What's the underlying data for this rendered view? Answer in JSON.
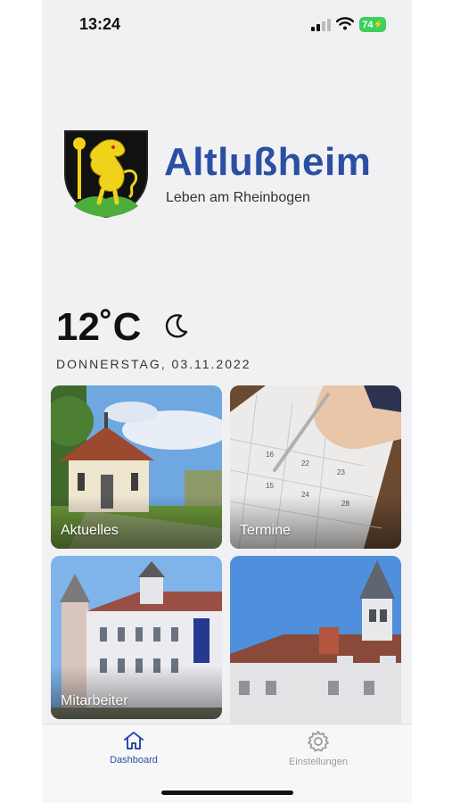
{
  "status_bar": {
    "time": "13:24",
    "battery": "74"
  },
  "brand": {
    "title": "Altlußheim",
    "subtitle": "Leben am Rheinbogen"
  },
  "weather": {
    "temperature": "12˚C",
    "condition_icon": "moon-icon"
  },
  "date": "DONNERSTAG, 03.11.2022",
  "tiles": [
    {
      "label": "Aktuelles"
    },
    {
      "label": "Termine"
    },
    {
      "label": "Mitarbeiter"
    },
    {
      "label": ""
    }
  ],
  "tabbar": {
    "items": [
      {
        "label": "Dashboard",
        "icon": "home-icon",
        "active": true
      },
      {
        "label": "Einstellungen",
        "icon": "gear-icon",
        "active": false
      }
    ]
  },
  "colors": {
    "brand_blue": "#2a4fa3",
    "background": "#f1f1f3",
    "battery_green": "#3bd15a"
  }
}
